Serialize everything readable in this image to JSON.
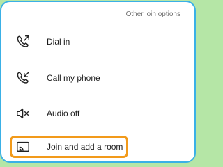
{
  "panel": {
    "header": "Other join options",
    "items": [
      {
        "label": "Dial in",
        "icon": "phone-outgoing-icon"
      },
      {
        "label": "Call my phone",
        "icon": "phone-incoming-icon"
      },
      {
        "label": "Audio off",
        "icon": "speaker-muted-icon"
      },
      {
        "label": "Join and add a room",
        "icon": "cast-screen-icon"
      }
    ]
  },
  "colors": {
    "page_background": "#b5e6a6",
    "panel_border": "#3ab0e6",
    "highlight": "#f29a1a",
    "text": "#1c1c1c",
    "header_text": "#6f6f6f"
  }
}
